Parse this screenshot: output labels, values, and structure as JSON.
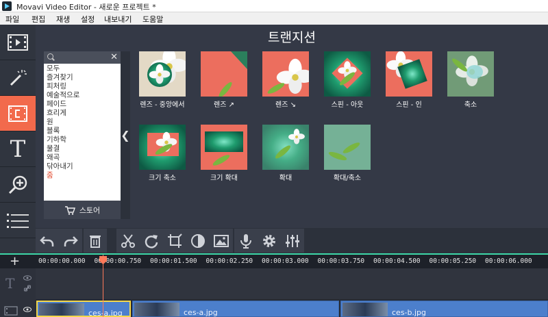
{
  "window": {
    "title": "Movavi Video Editor - 새로운 프로젝트 *"
  },
  "menu": [
    "파일",
    "편집",
    "재생",
    "설정",
    "내보내기",
    "도움말"
  ],
  "left_toolbar": [
    {
      "name": "import-icon",
      "active": false
    },
    {
      "name": "magic-wand-icon",
      "active": false
    },
    {
      "name": "transitions-icon",
      "active": true
    },
    {
      "name": "titles-icon",
      "active": false,
      "glyph": "T"
    },
    {
      "name": "zoom-icon",
      "active": false
    },
    {
      "name": "more-icon",
      "active": false
    }
  ],
  "panel": {
    "title": "트랜지션"
  },
  "categories": {
    "search_placeholder": "",
    "items": [
      "모두",
      "즐겨찾기",
      "피처링",
      "예술적으로",
      "페이드",
      "흐리게",
      "원",
      "블록",
      "기하학",
      "물결",
      "왜곡",
      "닦아내기",
      "줌"
    ],
    "active_index": 12,
    "store_label": "스토어"
  },
  "transitions": [
    {
      "label": "렌즈 - 중앙에서",
      "style": "lens-center"
    },
    {
      "label": "렌즈 ↗",
      "style": "red-corner"
    },
    {
      "label": "렌즈 ↘",
      "style": "red-flower"
    },
    {
      "label": "스핀 - 아웃",
      "style": "spin-out"
    },
    {
      "label": "스핀 - 인",
      "style": "spin-in"
    },
    {
      "label": "축소",
      "style": "shrink"
    },
    {
      "label": "크기 축소",
      "style": "scale-down"
    },
    {
      "label": "크기 확대",
      "style": "scale-up"
    },
    {
      "label": "확대",
      "style": "zoom"
    },
    {
      "label": "확대/축소",
      "style": "zoom-inout"
    }
  ],
  "edit_toolbar": [
    "undo-icon",
    "redo-icon",
    "delete-icon",
    "cut-icon",
    "rotate-icon",
    "crop-icon",
    "color-icon",
    "image-icon",
    "mic-icon",
    "settings-icon",
    "equalizer-icon"
  ],
  "timeline": {
    "ruler": [
      "00:00:00.000",
      "00:00:00.750",
      "00:00:01.500",
      "00:00:02.250",
      "00:00:03.000",
      "00:00:03.750",
      "00:00:04.500",
      "00:00:05.250",
      "00:00:06.000"
    ],
    "clips": [
      {
        "name": "ces-a.jpg",
        "selected": true
      },
      {
        "name": "ces-a.jpg",
        "selected": false
      },
      {
        "name": "ces-b.jpg",
        "selected": false
      }
    ]
  },
  "colors": {
    "accent": "#f26a4c",
    "panel": "#343946",
    "timeline_line": "#3dd7a8",
    "clip": "#4c7fcc"
  }
}
